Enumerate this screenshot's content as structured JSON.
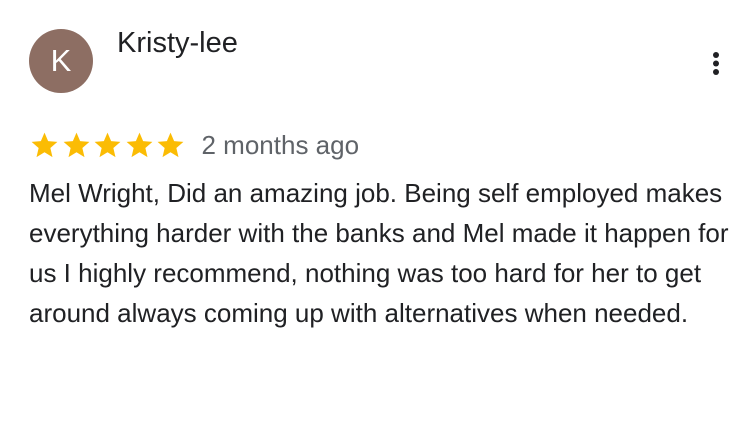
{
  "review": {
    "avatar_letter": "K",
    "avatar_color": "#8d6e63",
    "author": "Kristy-lee",
    "rating": 5,
    "rating_max": 5,
    "star_color": "#fbbc04",
    "time": "2 months ago",
    "more_icon": "more-vert-icon",
    "text": "Mel Wright, Did an amazing job. Being self employed makes everything harder with the banks and Mel made it happen for us I highly recommend, nothing was too hard for her to get around always coming up with alternatives when needed."
  }
}
